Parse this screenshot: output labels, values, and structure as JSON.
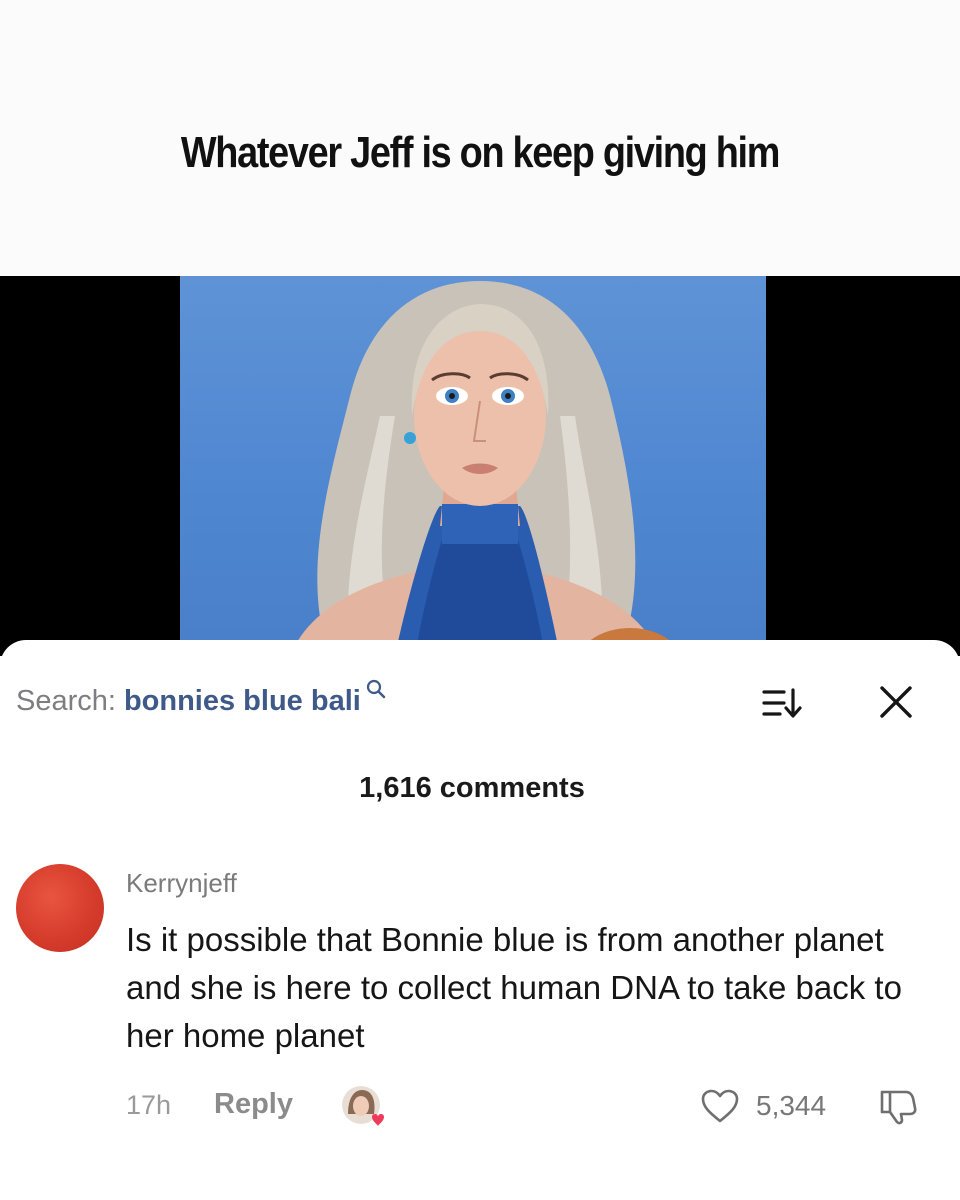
{
  "caption": {
    "text": "Whatever Jeff is on keep giving him"
  },
  "video": {
    "image": "woman-portrait-blue-background"
  },
  "search": {
    "prefix": "Search:",
    "query": "bonnies blue bali"
  },
  "comments_header": {
    "count_label": "1,616 comments"
  },
  "comment": {
    "username": "Kerrynjeff",
    "text": "Is it possible that Bonnie blue is from another planet and she is here to collect human DNA to take back to her home planet",
    "time": "17h",
    "reply_label": "Reply",
    "likes": "5,344"
  },
  "colors": {
    "search_query": "#3f5a88",
    "avatar": "#d63c2c",
    "photo_background": "#5a8fd6"
  },
  "icons": [
    "search-icon",
    "sort-icon",
    "close-icon",
    "heart-icon",
    "dislike-icon"
  ]
}
